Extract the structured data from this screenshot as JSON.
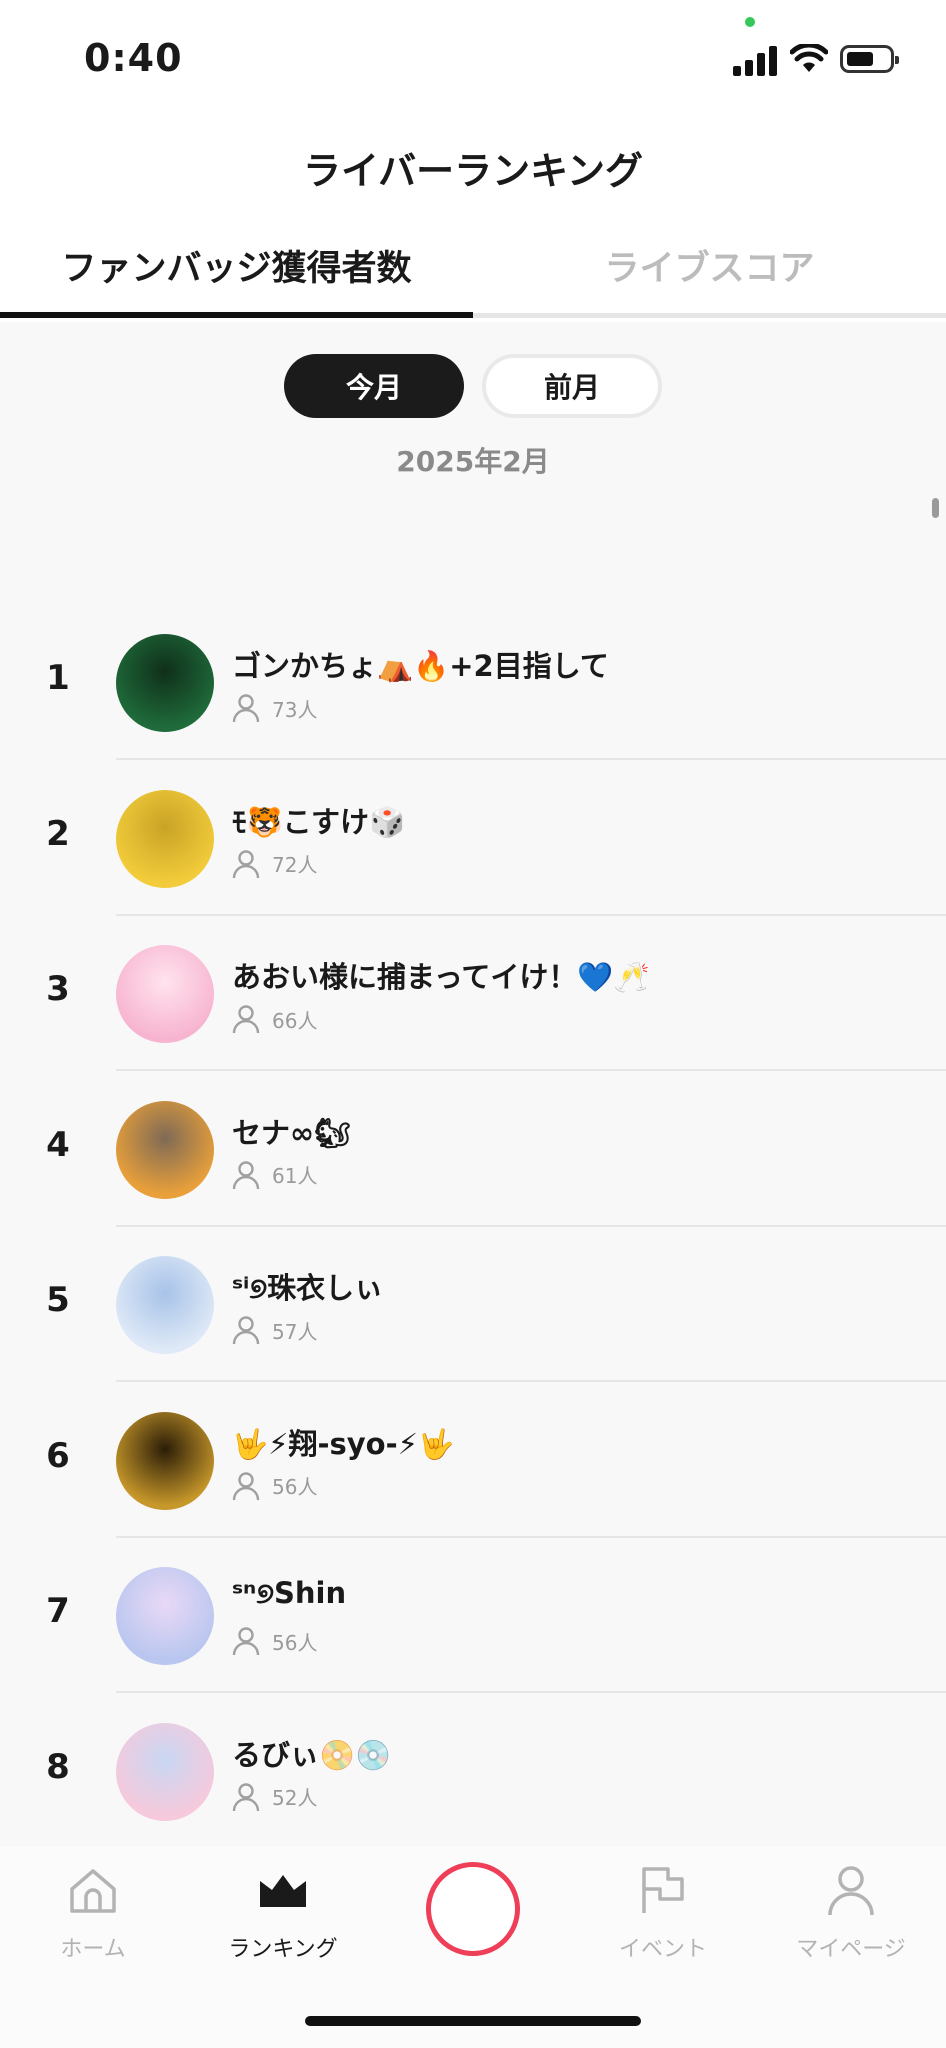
{
  "status_bar": {
    "time": "0:40"
  },
  "header": {
    "title": "ライバーランキング"
  },
  "tabs": [
    {
      "label": "ファンバッジ獲得者数",
      "active": true
    },
    {
      "label": "ライブスコア",
      "active": false
    }
  ],
  "period_toggle": {
    "current": "今月",
    "previous": "前月",
    "selected": "今月"
  },
  "period_label": "2025年2月",
  "rankings": [
    {
      "rank": "1",
      "name": "ゴンかちょ⛺🔥+2目指して",
      "fans": "73人",
      "avatar_colors": [
        "#1f6b3a",
        "#0f2f1a"
      ]
    },
    {
      "rank": "2",
      "name": "ﾓ🐯こすけ🎲",
      "fans": "72人",
      "avatar_colors": [
        "#f2cc3a",
        "#c9a326"
      ]
    },
    {
      "rank": "3",
      "name": "あおい様に捕まってイけ！💙🥂",
      "fans": "66人",
      "avatar_colors": [
        "#f7b4d0",
        "#ffe3ee"
      ]
    },
    {
      "rank": "4",
      "name": "セナ∞🐿",
      "fans": "61人",
      "avatar_colors": [
        "#e9a03a",
        "#7f6a55"
      ]
    },
    {
      "rank": "5",
      "name": "ˢⁱ୭珠衣しぃ",
      "fans": "57人",
      "avatar_colors": [
        "#dfe9f7",
        "#a7c3e8"
      ]
    },
    {
      "rank": "6",
      "name": "🤟⚡翔-syo-⚡🤟",
      "fans": "56人",
      "avatar_colors": [
        "#c6972a",
        "#2b1d07"
      ]
    },
    {
      "rank": "7",
      "name": "ˢⁿ୭Shin",
      "fans": "56人",
      "avatar_colors": [
        "#b9c6ef",
        "#e9d9f6"
      ]
    },
    {
      "rank": "8",
      "name": "るびぃ📀💿",
      "fans": "52人",
      "avatar_colors": [
        "#f6c9dc",
        "#c8d7f2"
      ]
    }
  ],
  "bottom_nav": [
    {
      "label": "ホーム",
      "icon": "home-icon",
      "active": false
    },
    {
      "label": "ランキング",
      "icon": "crown-icon",
      "active": true
    },
    {
      "label": "イベント",
      "icon": "flag-icon",
      "active": false
    },
    {
      "label": "マイページ",
      "icon": "person-icon",
      "active": false
    }
  ],
  "colors": {
    "accent": "#ee3e58",
    "active_tab": "#111111",
    "inactive_tab": "#bcbcbc"
  }
}
